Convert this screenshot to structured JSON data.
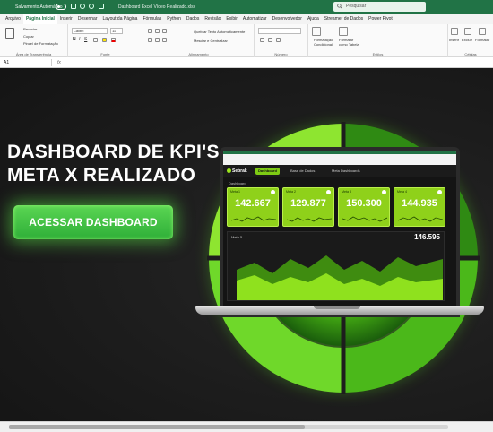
{
  "titlebar": {
    "autosave_label": "Salvamento Automático",
    "document_title": "Dashboard Excel Vídeo Realizado.xlsx",
    "search_placeholder": "Pesquisar"
  },
  "menu_tabs": [
    "Arquivo",
    "Página Inicial",
    "Inserir",
    "Desenhar",
    "Layout da Página",
    "Fórmulas",
    "Python",
    "Dados",
    "Revisão",
    "Exibir",
    "Automatizar",
    "Desenvolvedor",
    "Ajuda",
    "Streamer de Dados",
    "Power Pivot"
  ],
  "active_tab": "Página Inicial",
  "ribbon": {
    "clipboard": {
      "cut": "Recortar",
      "copy": "Copiar",
      "paint": "Pincel de Formatação",
      "label": "Área de Transferência"
    },
    "font": {
      "name": "Calibri",
      "size": "11",
      "label": "Fonte"
    },
    "alignment": {
      "wrap": "Quebrar Texto Automaticamente",
      "merge": "Mesclar e Centralizar",
      "label": "Alinhamento"
    },
    "number": {
      "label": "Número"
    },
    "styles": {
      "conditional": "Formatação Condicional",
      "table": "Formatar como Tabela",
      "label": "Estilos"
    },
    "cells": {
      "insert": "Inserir",
      "delete": "Excluir",
      "format": "Formatar",
      "label": "Células"
    }
  },
  "formula_bar": {
    "name_box": "A1",
    "fx": "fx"
  },
  "sheet": {
    "headline_line1": "DASHBOARD DE KPI'S",
    "headline_line2": "META X REALIZADO",
    "cta_label": "ACESSAR DASHBOARD",
    "accent_color": "#7ecb14"
  },
  "laptop_dashboard": {
    "logo": "Sebrak",
    "nav": [
      "Dashboard",
      "Base de Dados",
      "Meta Dashboards"
    ],
    "section_label": "Dashboard",
    "cards": [
      {
        "title": "Meta 1",
        "value": "142.667"
      },
      {
        "title": "Meta 2",
        "value": "129.877"
      },
      {
        "title": "Meta 3",
        "value": "150.300"
      },
      {
        "title": "Meta 4",
        "value": "144.935"
      }
    ],
    "panel_title": "Meta 5",
    "panel_value": "146.595"
  }
}
